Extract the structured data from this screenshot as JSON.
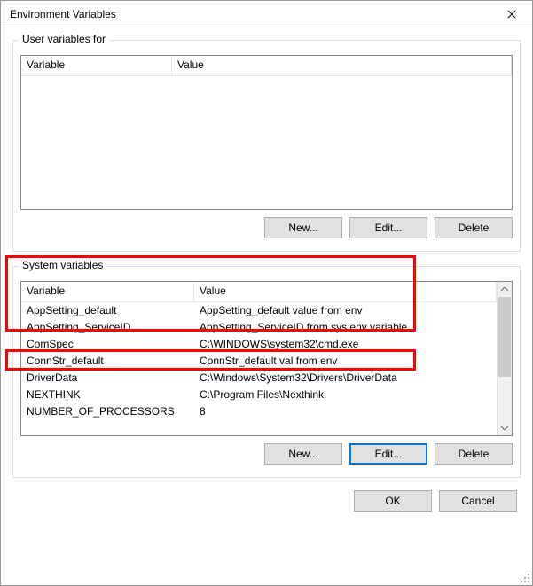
{
  "window": {
    "title": "Environment Variables"
  },
  "user_section": {
    "legend": "User variables for",
    "columns": {
      "variable": "Variable",
      "value": "Value"
    },
    "rows": [],
    "buttons": {
      "new": "New...",
      "edit": "Edit...",
      "delete": "Delete"
    }
  },
  "system_section": {
    "legend": "System variables",
    "columns": {
      "variable": "Variable",
      "value": "Value"
    },
    "rows": [
      {
        "variable": "AppSetting_default",
        "value": "AppSetting_default value from env"
      },
      {
        "variable": "AppSetting_ServiceID",
        "value": "AppSetting_ServiceID from sys env variable"
      },
      {
        "variable": "ComSpec",
        "value": "C:\\WINDOWS\\system32\\cmd.exe"
      },
      {
        "variable": "ConnStr_default",
        "value": "ConnStr_default val from env"
      },
      {
        "variable": "DriverData",
        "value": "C:\\Windows\\System32\\Drivers\\DriverData"
      },
      {
        "variable": "NEXTHINK",
        "value": "C:\\Program Files\\Nexthink"
      },
      {
        "variable": "NUMBER_OF_PROCESSORS",
        "value": "8"
      }
    ],
    "buttons": {
      "new": "New...",
      "edit": "Edit...",
      "delete": "Delete"
    }
  },
  "dialog_buttons": {
    "ok": "OK",
    "cancel": "Cancel"
  }
}
